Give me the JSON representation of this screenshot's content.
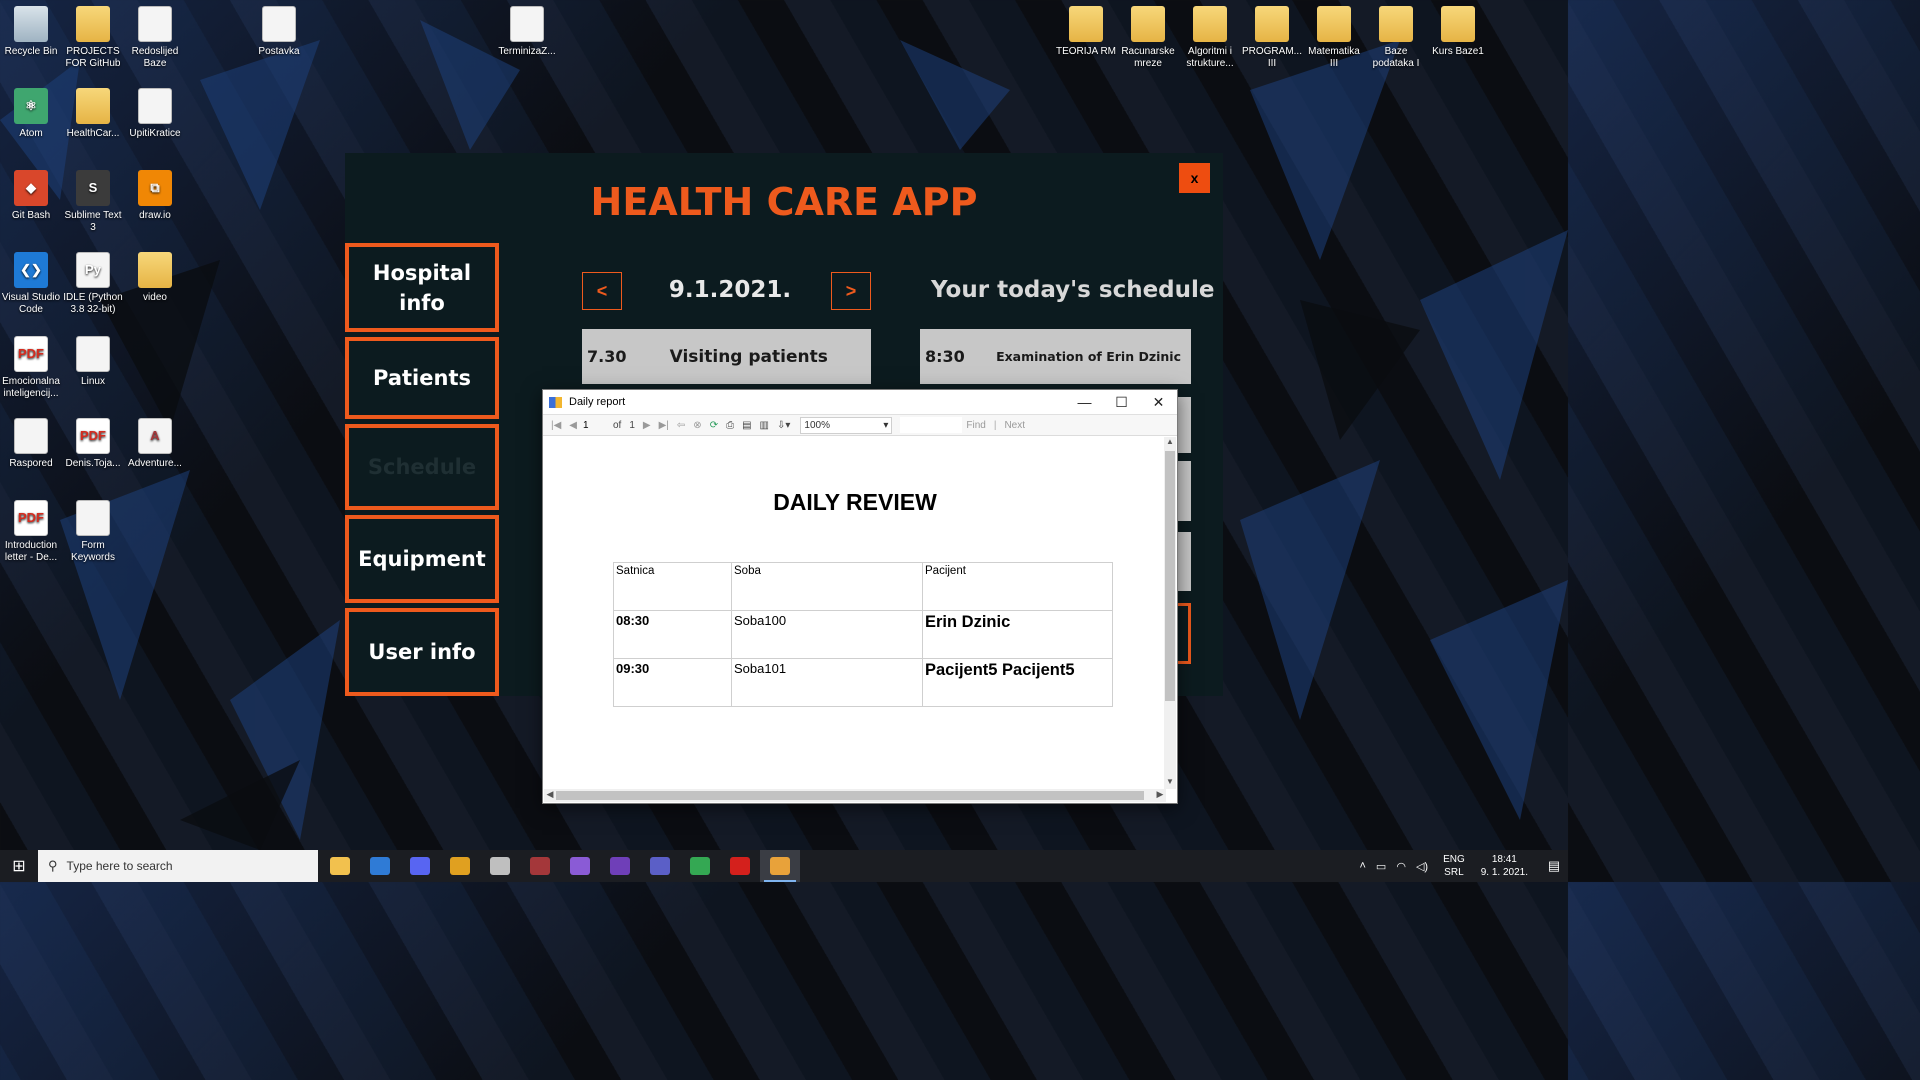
{
  "desktop": {
    "icons": [
      {
        "label": "Recycle Bin",
        "icon": "recycle-bin-icon"
      },
      {
        "label": "PROJECTS FOR GitHub",
        "icon": "folder-icon"
      },
      {
        "label": "Redoslijed Baze",
        "icon": "document-icon"
      },
      {
        "label": "Postavka",
        "icon": "archive-icon"
      },
      {
        "label": "TerminizaZ...",
        "icon": "calendar-file-icon"
      },
      {
        "label": "TEORIJA RM",
        "icon": "folder-icon"
      },
      {
        "label": "Racunarske mreze",
        "icon": "folder-icon"
      },
      {
        "label": "Algoritmi i strukture...",
        "icon": "folder-icon"
      },
      {
        "label": "PROGRAM... III",
        "icon": "pdf-folder-icon"
      },
      {
        "label": "Matematika III",
        "icon": "folder-icon"
      },
      {
        "label": "Baze podataka I",
        "icon": "folder-icon"
      },
      {
        "label": "Kurs Baze1",
        "icon": "folder-icon"
      },
      {
        "label": "Atom",
        "icon": "atom-icon"
      },
      {
        "label": "HealthCar...",
        "icon": "folder-icon"
      },
      {
        "label": "UpitiKratice",
        "icon": "document-icon"
      },
      {
        "label": "Git Bash",
        "icon": "git-bash-icon"
      },
      {
        "label": "Sublime Text 3",
        "icon": "sublime-text-icon"
      },
      {
        "label": "draw.io",
        "icon": "drawio-icon"
      },
      {
        "label": "Visual Studio Code",
        "icon": "vscode-icon"
      },
      {
        "label": "IDLE (Python 3.8 32-bit)",
        "icon": "python-icon"
      },
      {
        "label": "video",
        "icon": "video-folder-icon"
      },
      {
        "label": "Emocionalna inteligencij...",
        "icon": "pdf-icon"
      },
      {
        "label": "Linux",
        "icon": "document-icon"
      },
      {
        "label": "Raspored",
        "icon": "image-file-icon"
      },
      {
        "label": "Denis.Toja...",
        "icon": "pdf-icon"
      },
      {
        "label": "Adventure...",
        "icon": "access-icon"
      },
      {
        "label": "Introduction letter - De...",
        "icon": "pdf-icon"
      },
      {
        "label": "Form Keywords",
        "icon": "document-icon"
      }
    ]
  },
  "app": {
    "title": "HEALTH CARE APP",
    "close_label": "x",
    "nav": [
      {
        "label": "Hospital info"
      },
      {
        "label": "Patients"
      },
      {
        "label": "Schedule"
      },
      {
        "label": "Equipment"
      },
      {
        "label": "User info"
      }
    ],
    "prev_label": "<",
    "next_label": ">",
    "date": "9.1.2021.",
    "schedule_title": "Your today's schedule",
    "cards": [
      {
        "time": "7.30",
        "label": "Visiting patients"
      },
      {
        "time": "8:30",
        "label": "Examination of Erin Dzinic"
      }
    ]
  },
  "report_window": {
    "title": "Daily report",
    "controls": {
      "minimize": "—",
      "maximize": "☐",
      "close": "✕"
    },
    "toolbar": {
      "page": "1",
      "of_label": "of",
      "total_pages": "1",
      "zoom": "100%",
      "find_label": "Find",
      "next_label": "Next"
    },
    "report_title": "DAILY REVIEW",
    "columns": [
      "Satnica",
      "Soba",
      "Pacijent"
    ],
    "rows": [
      {
        "time": "08:30",
        "room": "Soba100",
        "patient": "Erin Dzinic"
      },
      {
        "time": "09:30",
        "room": "Soba101",
        "patient": "Pacijent5 Pacijent5"
      }
    ]
  },
  "taskbar": {
    "search_placeholder": "Type here to search",
    "apps": [
      {
        "icon": "file-explorer-icon",
        "color": "#f2c14e"
      },
      {
        "icon": "mail-icon",
        "color": "#2f7bd6"
      },
      {
        "icon": "discord-icon",
        "color": "#5865f2"
      },
      {
        "icon": "git-icon",
        "color": "#e0a020"
      },
      {
        "icon": "database-icon",
        "color": "#bfbfbf"
      },
      {
        "icon": "access-icon",
        "color": "#a4373a"
      },
      {
        "icon": "visual-studio-purple-icon",
        "color": "#8a5bd6"
      },
      {
        "icon": "visual-studio-icon",
        "color": "#6f3fb8"
      },
      {
        "icon": "teams-icon",
        "color": "#5b5fc7"
      },
      {
        "icon": "chrome-icon",
        "color": "#34a853"
      },
      {
        "icon": "acrobat-icon",
        "color": "#d4201c"
      },
      {
        "icon": "report-app-icon",
        "color": "#e8a23a"
      }
    ],
    "lang_top": "ENG",
    "lang_bottom": "SRL",
    "time": "18:41",
    "date": "9. 1. 2021."
  }
}
